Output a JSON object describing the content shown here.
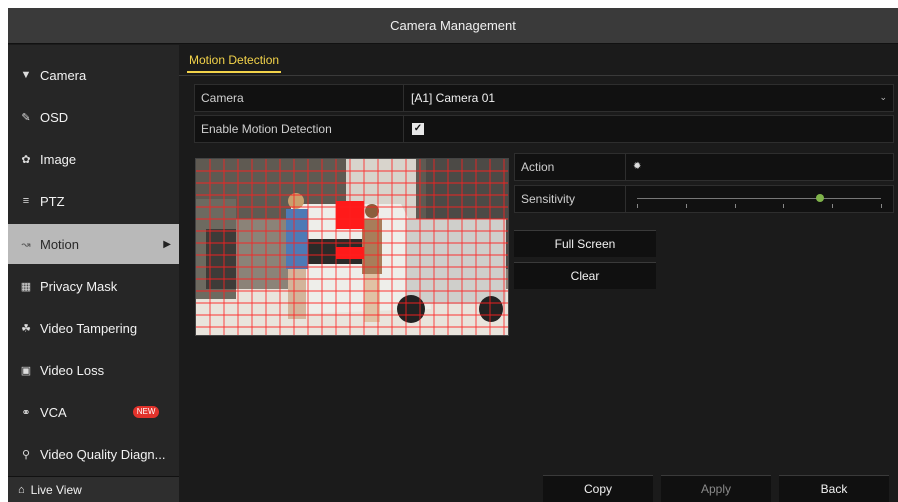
{
  "window": {
    "title": "Camera Management"
  },
  "sidebar": {
    "items": [
      {
        "label": "Camera",
        "icon": "camera-icon"
      },
      {
        "label": "OSD",
        "icon": "osd-icon"
      },
      {
        "label": "Image",
        "icon": "image-icon"
      },
      {
        "label": "PTZ",
        "icon": "ptz-icon"
      },
      {
        "label": "Motion",
        "icon": "motion-icon",
        "active": true
      },
      {
        "label": "Privacy Mask",
        "icon": "privacy-mask-icon"
      },
      {
        "label": "Video Tampering",
        "icon": "video-tampering-icon"
      },
      {
        "label": "Video Loss",
        "icon": "video-loss-icon"
      },
      {
        "label": "VCA",
        "icon": "vca-icon",
        "badge": "NEW"
      },
      {
        "label": "Video Quality Diagn...",
        "icon": "video-quality-icon"
      }
    ],
    "live_view": "Live View"
  },
  "tabs": [
    {
      "label": "Motion Detection",
      "active": true
    }
  ],
  "form": {
    "camera_label": "Camera",
    "camera_value": "[A1] Camera 01",
    "enable_label": "Enable Motion Detection",
    "enable_checked": true,
    "action_label": "Action",
    "sensitivity_label": "Sensitivity",
    "sensitivity_level": 0.75
  },
  "buttons": {
    "full_screen": "Full Screen",
    "clear": "Clear",
    "copy": "Copy",
    "apply": "Apply",
    "back": "Back"
  },
  "colors": {
    "accent": "#f3d34a",
    "active_bg": "#b9b9b9",
    "motion_grid": "#ff2020",
    "badge": "#e2322b"
  }
}
